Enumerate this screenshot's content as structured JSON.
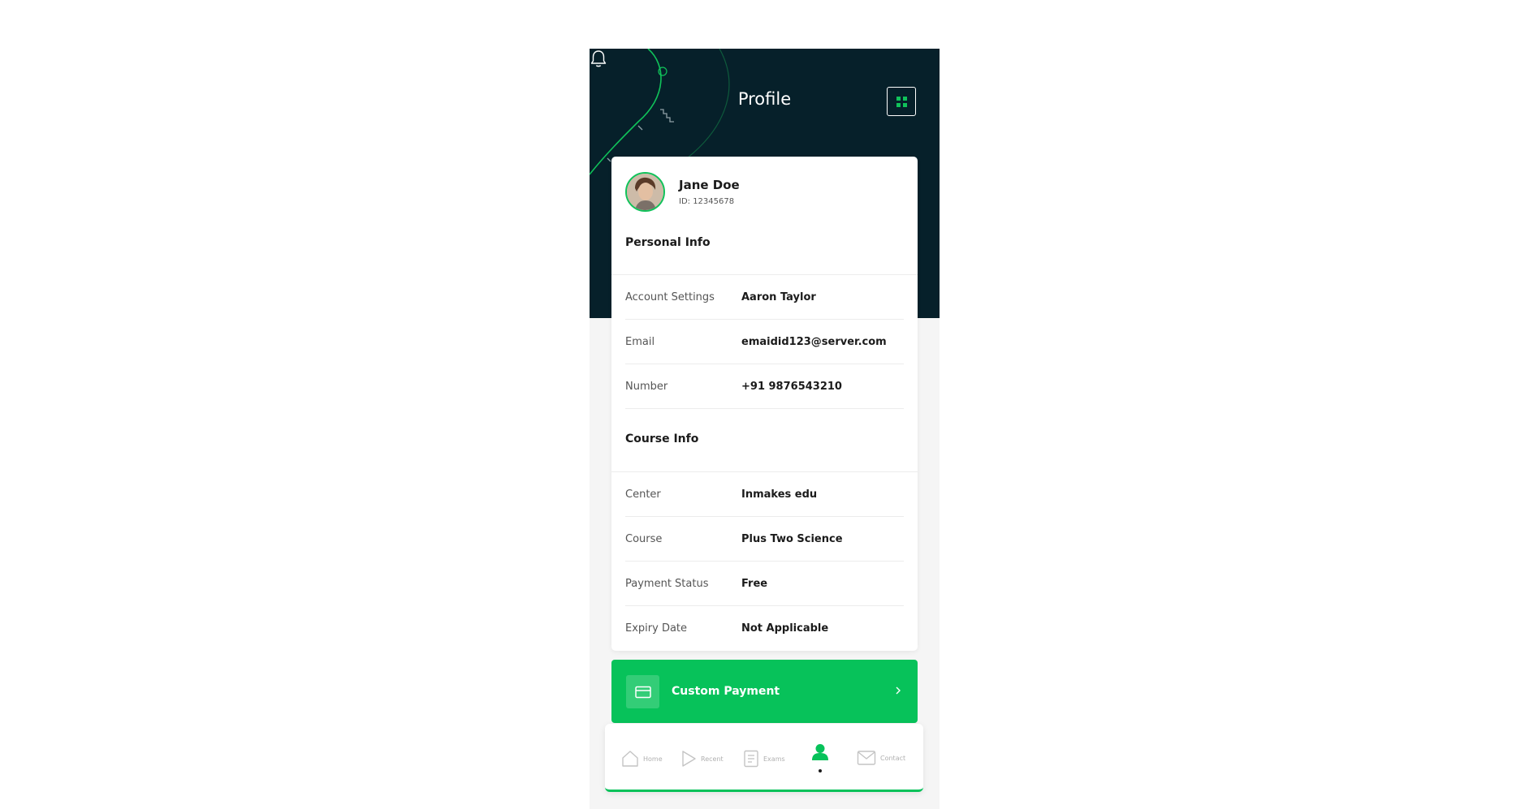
{
  "header": {
    "title": "Profile"
  },
  "profile": {
    "name": "Jane Doe",
    "id": "ID: 12345678"
  },
  "personal_info": {
    "title": "Personal Info",
    "rows": [
      {
        "label": "Account Settings",
        "value": "Aaron Taylor"
      },
      {
        "label": "Email",
        "value": "emaidid123@server.com"
      },
      {
        "label": "Number",
        "value": "+91 9876543210"
      }
    ]
  },
  "course_info": {
    "title": "Course Info",
    "rows": [
      {
        "label": "Center",
        "value": "Inmakes edu"
      },
      {
        "label": "Course",
        "value": "Plus Two Science"
      },
      {
        "label": "Payment Status",
        "value": "Free"
      },
      {
        "label": "Expiry Date",
        "value": "Not Applicable"
      }
    ]
  },
  "payment_button": {
    "label": "Custom Payment"
  },
  "bottom_nav": {
    "items": [
      {
        "label": "Home",
        "icon": "home-icon"
      },
      {
        "label": "Recent",
        "icon": "play-icon"
      },
      {
        "label": "Exams",
        "icon": "document-icon"
      },
      {
        "label": "",
        "icon": "user-icon",
        "active": true
      },
      {
        "label": "Contact",
        "icon": "mail-icon"
      }
    ]
  },
  "colors": {
    "header_bg": "#06202a",
    "accent": "#07c25a",
    "page_bg": "#f5f5f5"
  }
}
